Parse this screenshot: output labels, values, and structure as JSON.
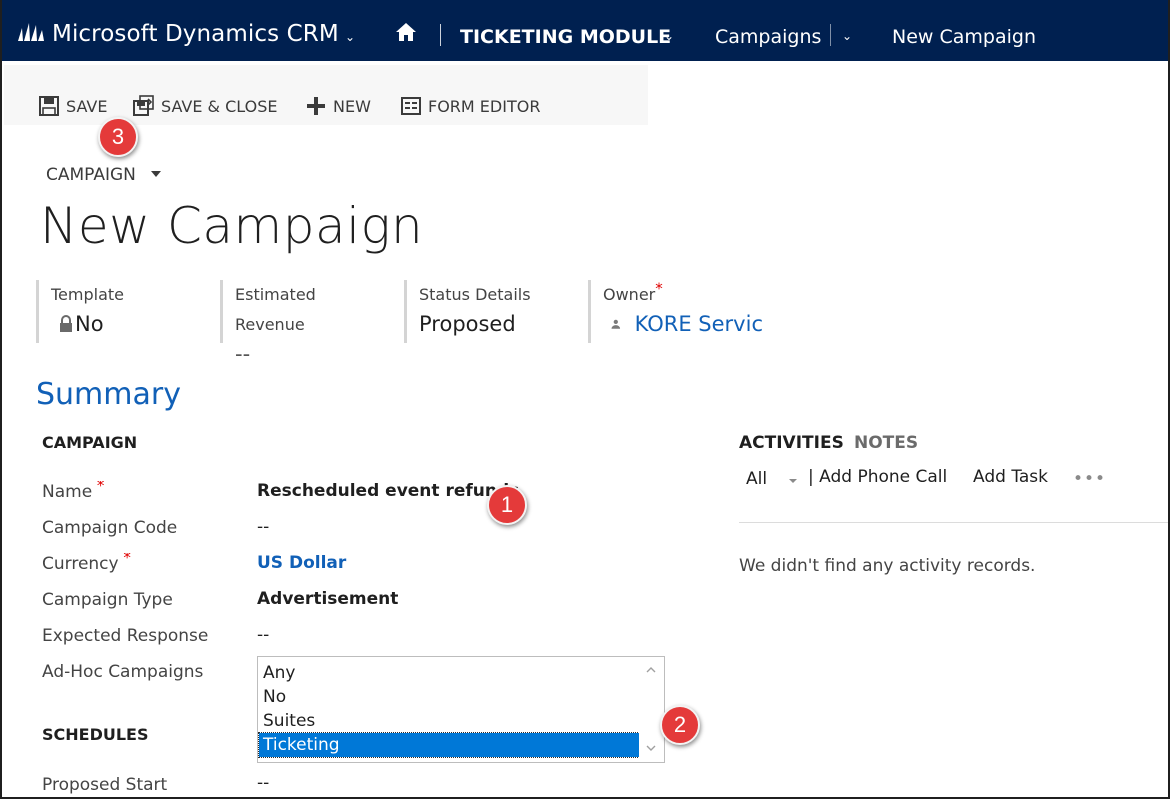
{
  "nav": {
    "brand": "Microsoft Dynamics CRM",
    "module": "TICKETING MODULE",
    "area": "Campaigns",
    "breadcrumb": "New Campaign"
  },
  "commands": {
    "save": "SAVE",
    "save_close": "SAVE & CLOSE",
    "new": "NEW",
    "form_editor": "FORM EDITOR"
  },
  "callouts": [
    "1",
    "2",
    "3"
  ],
  "entity": "CAMPAIGN",
  "title": "New Campaign",
  "header_fields": {
    "template": {
      "label": "Template",
      "value": "No"
    },
    "revenue": {
      "label": "Estimated Revenue",
      "value": "--"
    },
    "status": {
      "label": "Status Details",
      "value": "Proposed"
    },
    "owner": {
      "label": "Owner",
      "value": "KORE Servic"
    }
  },
  "summary": {
    "title": "Summary",
    "campaign_heading": "CAMPAIGN",
    "schedules_heading": "SCHEDULES",
    "fields": {
      "name": {
        "label": "Name",
        "value": "Rescheduled event refunds"
      },
      "code": {
        "label": "Campaign Code",
        "value": "--"
      },
      "currency": {
        "label": "Currency",
        "value": "US Dollar"
      },
      "type": {
        "label": "Campaign Type",
        "value": "Advertisement"
      },
      "response": {
        "label": "Expected Response(%",
        "value": "--"
      },
      "adhoc": {
        "label": "Ad-Hoc Campaigns"
      },
      "proposed_start": {
        "label": "Proposed Start",
        "value": "--"
      }
    },
    "adhoc_options": [
      "Any",
      "No",
      "Suites",
      "Ticketing"
    ],
    "adhoc_selected": "Ticketing"
  },
  "activities": {
    "tab_activities": "ACTIVITIES",
    "tab_notes": "NOTES",
    "filter": "All",
    "add_phone": "| Add Phone Call",
    "add_task": "Add Task",
    "more": "•••",
    "empty": "We didn't find any activity records."
  },
  "colors": {
    "nav_bg": "#002050",
    "link": "#1160b7",
    "required": "#e00000",
    "selection": "#0078d7",
    "callout": "#e43a3a"
  }
}
